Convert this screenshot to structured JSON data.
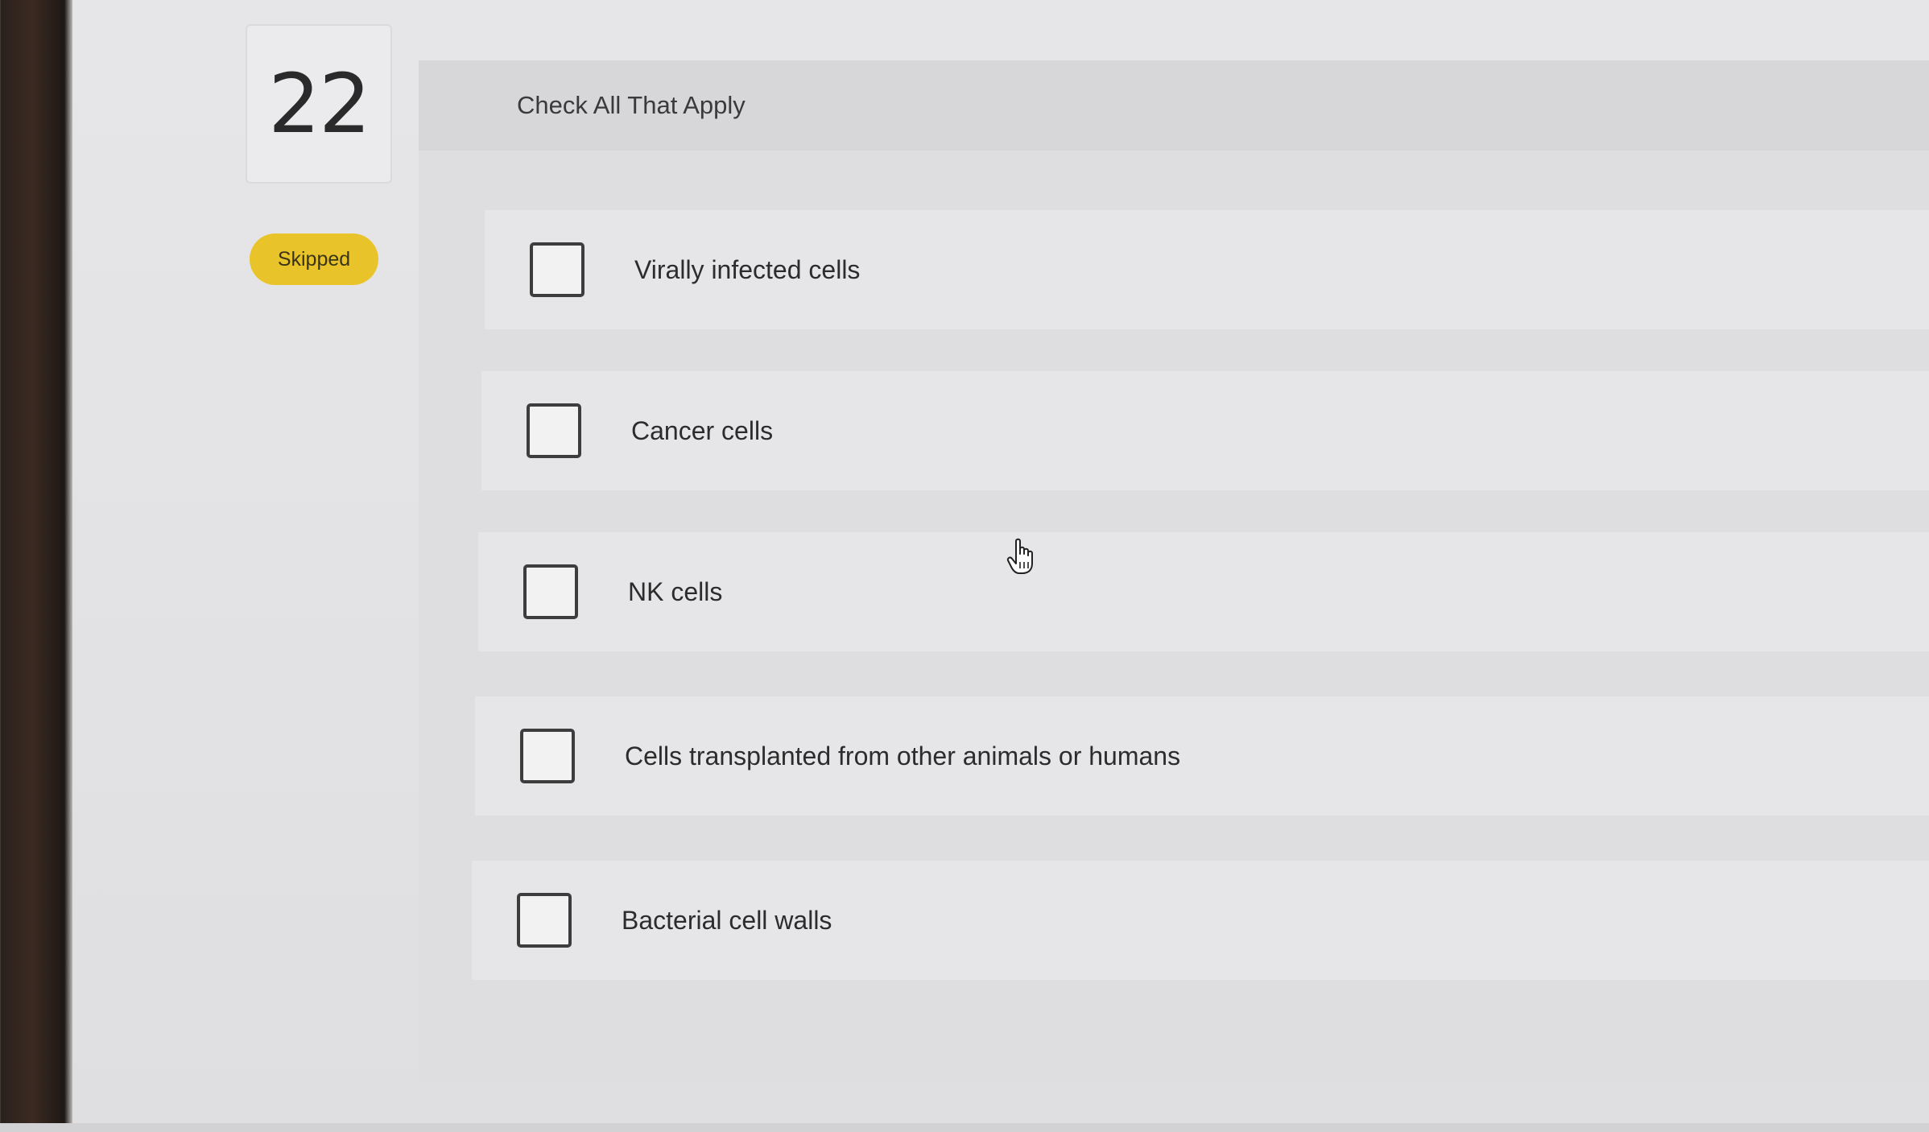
{
  "question": {
    "number": "22",
    "status": "Skipped",
    "instruction": "Check All That Apply"
  },
  "options": [
    {
      "label": "Virally infected cells",
      "checked": false
    },
    {
      "label": "Cancer cells",
      "checked": false
    },
    {
      "label": "NK cells",
      "checked": false
    },
    {
      "label": "Cells transplanted from other animals or humans",
      "checked": false
    },
    {
      "label": "Bacterial cell walls",
      "checked": false
    }
  ],
  "colors": {
    "status_badge": "#e8c42a",
    "checkbox_border": "#3d3d3d"
  },
  "icons": {
    "cursor": "hand-pointer-icon"
  }
}
